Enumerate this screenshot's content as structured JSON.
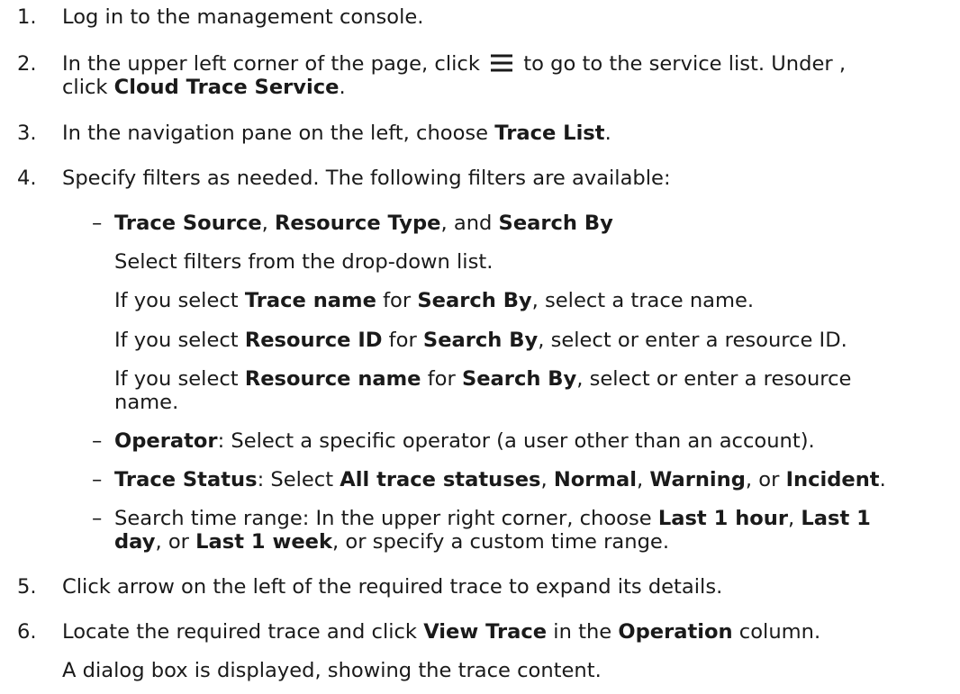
{
  "steps": [
    {
      "num": "1.",
      "parts": [
        "Log in to the management console."
      ]
    },
    {
      "num": "2.",
      "parts": [
        "In the upper left corner of the page, click ",
        "menu-icon",
        " to go to the service list. Under ,"
      ],
      "parts2": [
        "click ",
        {
          "b": "Cloud Trace Service"
        },
        "."
      ]
    },
    {
      "num": "3.",
      "parts": [
        "In the navigation pane on the left, choose ",
        {
          "b": "Trace List"
        },
        "."
      ]
    },
    {
      "num": "4.",
      "parts": [
        "Specify filters as needed. The following filters are available:"
      ]
    },
    {
      "num": "5.",
      "parts": [
        "Click arrow on the left of the required trace to expand its details."
      ]
    },
    {
      "num": "6.",
      "parts": [
        "Locate the required trace and click ",
        {
          "b": "View Trace"
        },
        " in the ",
        {
          "b": "Operation"
        },
        " column."
      ]
    }
  ],
  "filters": {
    "f1": {
      "dash": "–",
      "parts": [
        {
          "b": "Trace Source"
        },
        ", ",
        {
          "b": "Resource Type"
        },
        ", and ",
        {
          "b": "Search By"
        }
      ]
    },
    "f1_sub": [
      {
        "parts": [
          "Select filters from the drop-down list."
        ]
      },
      {
        "parts": [
          "If you select ",
          {
            "b": "Trace name"
          },
          " for ",
          {
            "b": "Search By"
          },
          ", select a trace name."
        ]
      },
      {
        "parts": [
          "If you select ",
          {
            "b": "Resource ID"
          },
          " for ",
          {
            "b": "Search By"
          },
          ", select or enter a resource ID."
        ]
      },
      {
        "parts": [
          "If you select ",
          {
            "b": "Resource name"
          },
          " for ",
          {
            "b": "Search By"
          },
          ", select or enter a resource"
        ]
      },
      {
        "parts": [
          "name."
        ]
      }
    ],
    "f2": {
      "dash": "–",
      "parts": [
        {
          "b": "Operator"
        },
        ": Select a specific operator (a user other than an account)."
      ]
    },
    "f3": {
      "dash": "–",
      "parts": [
        {
          "b": "Trace Status"
        },
        ": Select ",
        {
          "b": "All trace statuses"
        },
        ", ",
        {
          "b": "Normal"
        },
        ", ",
        {
          "b": "Warning"
        },
        ", or ",
        {
          "b": "Incident"
        },
        "."
      ]
    },
    "f4": {
      "dash": "–",
      "parts": [
        "Search time range: In the upper right corner, choose ",
        {
          "b": "Last 1 hour"
        },
        ", ",
        {
          "b": "Last 1"
        }
      ]
    },
    "f4_cont": {
      "parts": [
        {
          "b": "day"
        },
        ", or ",
        {
          "b": "Last 1 week"
        },
        ", or specify a custom time range."
      ]
    }
  },
  "step6_note": "A dialog box is displayed, showing the trace content."
}
